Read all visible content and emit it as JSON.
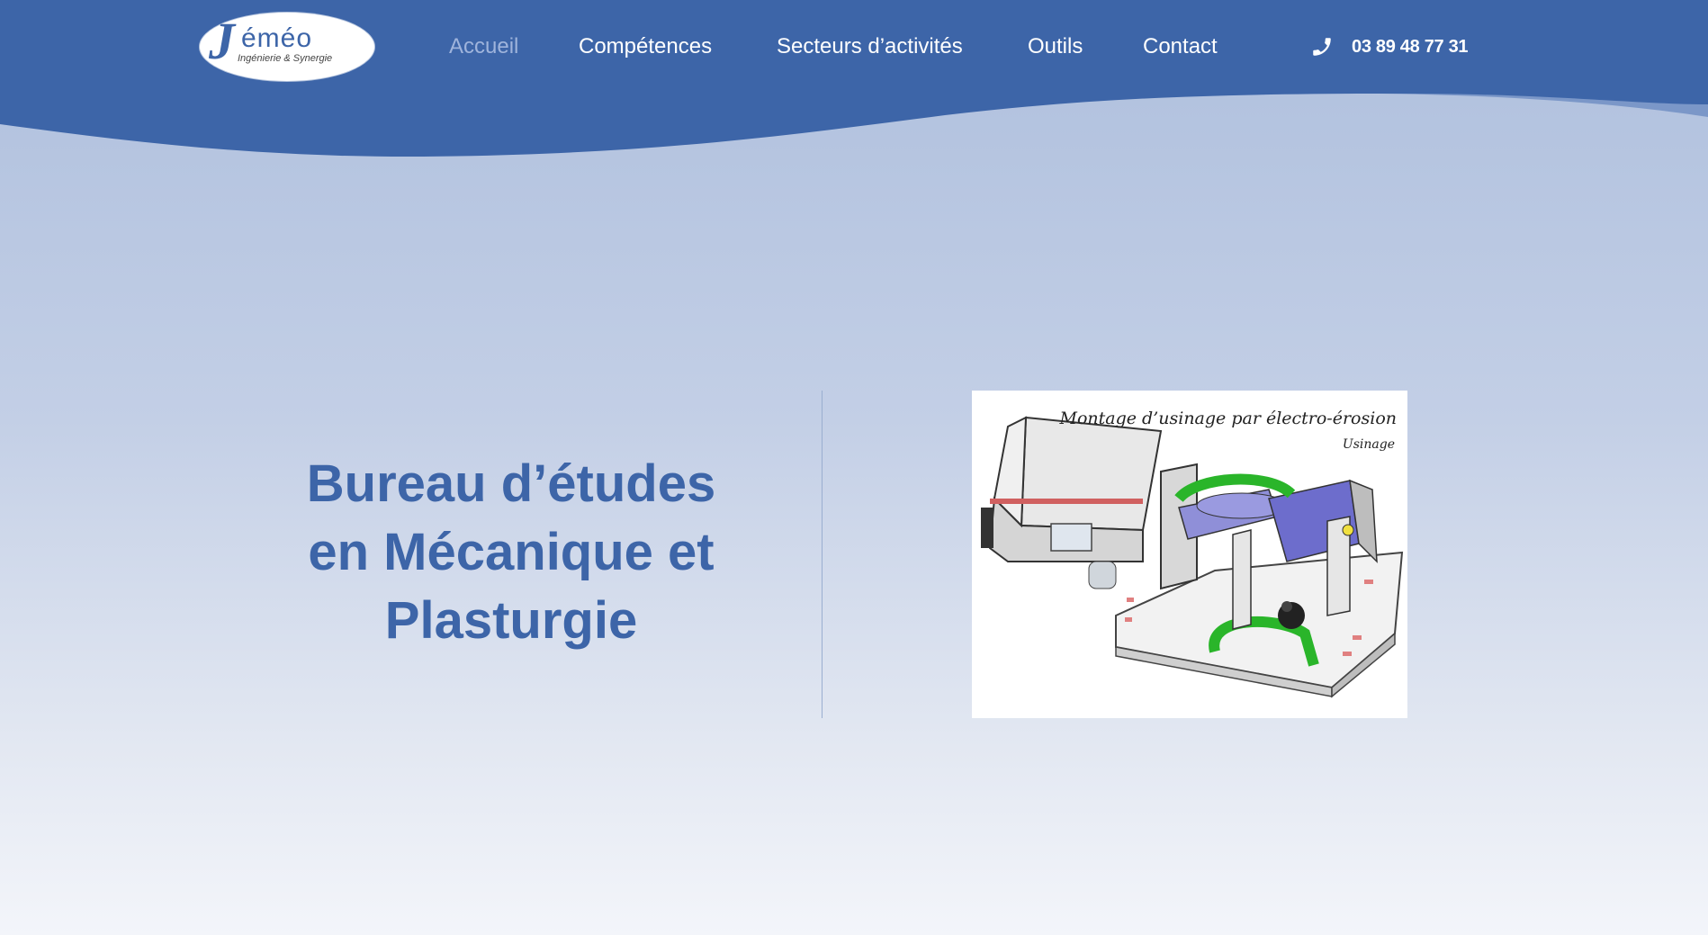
{
  "brand": {
    "logo_initial": "J",
    "logo_word": "éméo",
    "logo_tagline": "Ingénierie & Synergie"
  },
  "nav": {
    "items": [
      {
        "label": "Accueil",
        "active": true
      },
      {
        "label": "Compétences",
        "active": false
      },
      {
        "label": "Secteurs d’activités",
        "active": false
      },
      {
        "label": "Outils",
        "active": false
      },
      {
        "label": "Contact",
        "active": false
      }
    ]
  },
  "phone": {
    "icon": "phone-icon",
    "number": "03 89 48 77 31"
  },
  "hero": {
    "title_lines": [
      "Bureau d’études",
      "en Mécanique et",
      "Plasturgie"
    ]
  },
  "photo": {
    "caption": "Montage d’usinage par électro-érosion",
    "subcaption": "Usinage"
  },
  "colors": {
    "header_blue": "#3d65a8",
    "active_nav": "#9fb4dc",
    "title_blue": "#3d65a8"
  }
}
